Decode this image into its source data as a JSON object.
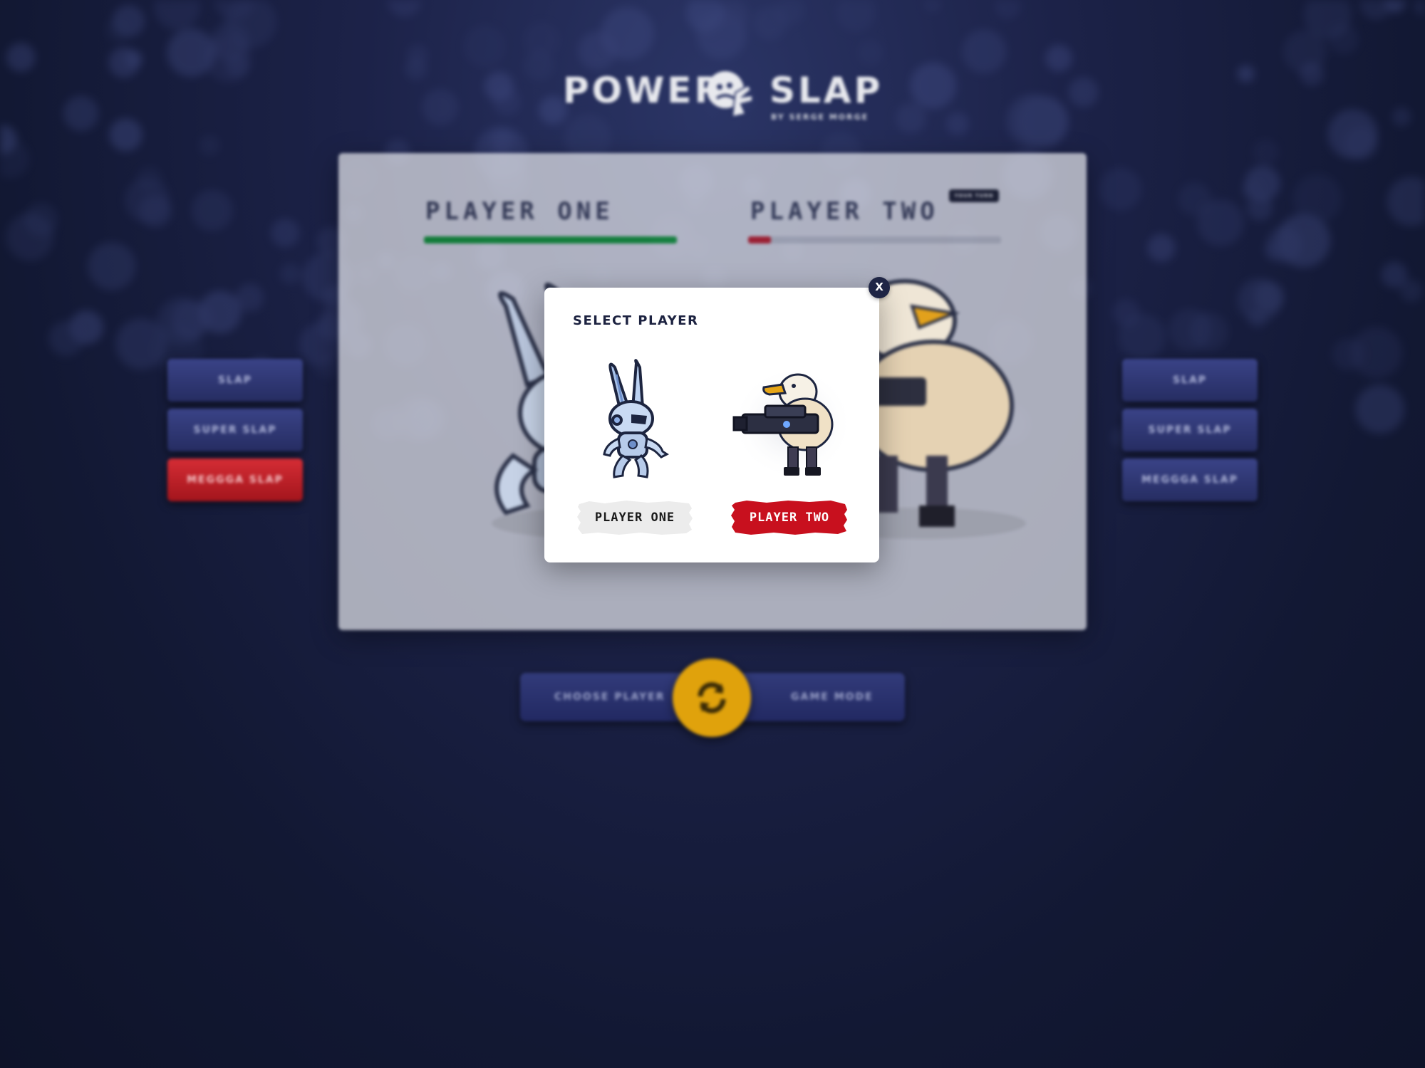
{
  "logo": {
    "word_left": "POWER",
    "word_right": "SLAP",
    "byline": "BY SERGE MORGE"
  },
  "board": {
    "player_one": {
      "title": "PLAYER ONE",
      "health": 1.0,
      "health_color": "#0f9d32"
    },
    "player_two": {
      "title": "PLAYER TWO",
      "health": 0.09,
      "health_color": "#c91b25",
      "badge": "YOUR TURN"
    }
  },
  "left_actions": [
    "SLAP",
    "SUPER SLAP",
    "MEGGGA SLAP"
  ],
  "right_actions": [
    "SLAP",
    "SUPER SLAP",
    "MEGGGA SLAP"
  ],
  "bottom_bar": {
    "choose_label": "CHOOSE PLAYER",
    "mode_label": "GAME MODE",
    "refresh_icon": "refresh-icon"
  },
  "modal": {
    "title": "SELECT PLAYER",
    "close_label": "X",
    "options": [
      {
        "label": "PLAYER ONE",
        "character": "robot-rabbit",
        "button_color": "#ececec"
      },
      {
        "label": "PLAYER TWO",
        "character": "eagle-gunner",
        "button_color": "#c8101e"
      }
    ]
  },
  "colors": {
    "accent_red": "#c8101e",
    "accent_gold": "#e0a20c",
    "navy": "#1f2545"
  }
}
